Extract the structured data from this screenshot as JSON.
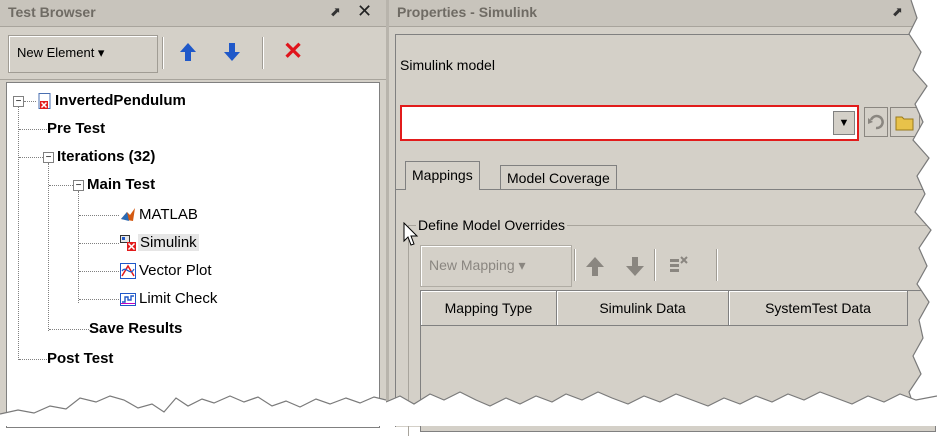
{
  "left_panel": {
    "title": "Test Browser",
    "pin_glyph": "⬈",
    "close_glyph": "✕",
    "toolbar": {
      "new_element_label": "New Element ▾"
    },
    "tree": {
      "root": "InvertedPendulum",
      "items": [
        {
          "label": "Pre Test"
        },
        {
          "label": "Iterations  (32)"
        },
        {
          "label": "Main Test"
        },
        {
          "label": "MATLAB"
        },
        {
          "label": "Simulink"
        },
        {
          "label": "Vector Plot"
        },
        {
          "label": "Limit Check"
        },
        {
          "label": "Save Results"
        },
        {
          "label": "Post Test"
        }
      ]
    }
  },
  "right_panel": {
    "title": "Properties - Simulink",
    "pin_glyph": "⬈",
    "close_glyph": "✕",
    "model_label": "Simulink model",
    "model_value": "",
    "tabs": [
      {
        "label": "Mappings",
        "active": true
      },
      {
        "label": "Model Coverage",
        "active": false
      }
    ],
    "group_label": "Define Model Overrides",
    "mapping_toolbar": {
      "new_mapping_label": "New Mapping ▾"
    },
    "table_headers": [
      "Mapping Type",
      "Simulink Data",
      "SystemTest Data"
    ]
  },
  "colors": {
    "panel_bg": "#d4d0c8",
    "accent_blue": "#1f58c9",
    "error_red": "#e21b1b",
    "disabled_gray": "#8a8680"
  },
  "icons": {
    "up_arrow": "up-arrow-icon",
    "down_arrow": "down-arrow-icon",
    "delete": "delete-icon",
    "refresh": "refresh-icon",
    "folder": "folder-open-icon"
  }
}
